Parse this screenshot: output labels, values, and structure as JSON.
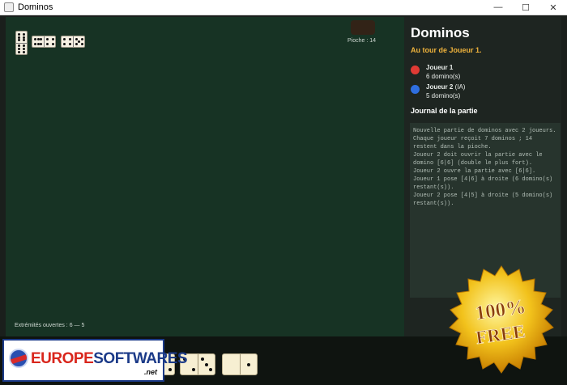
{
  "window": {
    "title": "Dominos",
    "controls": [
      "—",
      "☐",
      "✕"
    ]
  },
  "board": {
    "pioche": "Pioche : 14",
    "extremites": "Extrémités ouvertes : 6  —  5",
    "chain": [
      {
        "a": 6,
        "b": 6,
        "orientation": "v"
      },
      {
        "a": 6,
        "b": 4,
        "orientation": "h"
      },
      {
        "a": 4,
        "b": 5,
        "orientation": "h"
      }
    ]
  },
  "sidebar": {
    "title": "Dominos",
    "turn": "Au tour de Joueur 1.",
    "players": [
      {
        "name": "Joueur 1",
        "tag": "",
        "count": "6 domino(s)",
        "color": "#e03a34"
      },
      {
        "name": "Joueur 2",
        "tag": " (IA)",
        "count": "5 domino(s)",
        "color": "#2f6ee0"
      }
    ],
    "journal_title": "Journal de la partie",
    "journal": [
      "Nouvelle partie de dominos avec 2 joueurs. Chaque joueur reçoit 7 dominos ; 14 restent dans la pioche.",
      "Joueur 2 doit ouvrir la partie avec le domino [6|6] (double le plus fort).",
      "Joueur 2 ouvre la partie avec [6|6].",
      "Joueur 1 pose [4|6] à droite (6 domino(s) restant(s)).",
      "Joueur 2 pose [4|5] à droite (5 domino(s) restant(s))."
    ]
  },
  "hand": [
    {
      "a": 0,
      "b": 2
    },
    {
      "a": 2,
      "b": 3
    },
    {
      "a": 0,
      "b": 1
    }
  ],
  "watermark": {
    "logo_part1": "EUROPE",
    "logo_part2": "SOFTWARES",
    "logo_sub": ".net",
    "badge_line1": "100%",
    "badge_line2": "FREE"
  }
}
